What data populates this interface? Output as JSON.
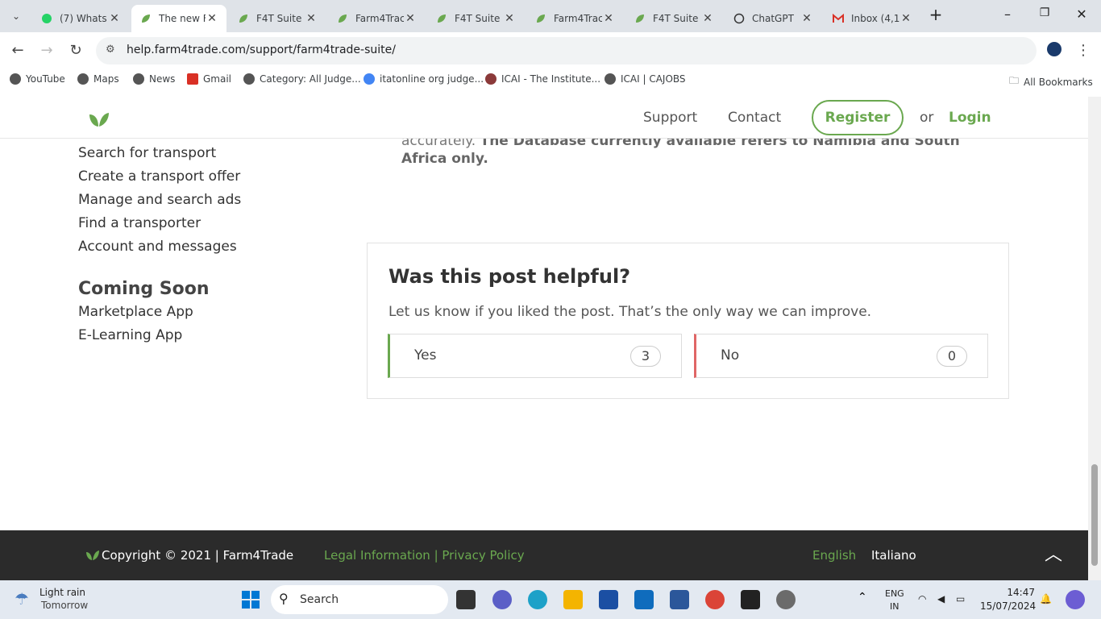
{
  "browser": {
    "tabs": [
      {
        "title": "(7) Whats",
        "active": false
      },
      {
        "title": "The new F",
        "active": true
      },
      {
        "title": "F4T Suite",
        "active": false
      },
      {
        "title": "Farm4Trac",
        "active": false
      },
      {
        "title": "F4T Suite",
        "active": false
      },
      {
        "title": "Farm4Trac",
        "active": false
      },
      {
        "title": "F4T Suite",
        "active": false
      },
      {
        "title": "ChatGPT",
        "active": false
      },
      {
        "title": "Inbox (4,1",
        "active": false
      }
    ],
    "url": "help.farm4trade.com/support/farm4trade-suite/",
    "bookmarks": [
      "YouTube",
      "Maps",
      "News",
      "Gmail",
      "Category: All Judge...",
      "itatonline org judge...",
      "ICAI - The Institute...",
      "ICAI | CAJOBS"
    ],
    "all_bookmarks": "All Bookmarks"
  },
  "header": {
    "support": "Support",
    "contact": "Contact",
    "register": "Register",
    "or": "or",
    "login": "Login"
  },
  "sidebar": {
    "links": [
      "Search for transport",
      "Create a transport offer",
      "Manage and search ads",
      "Find a transporter",
      "Account and messages"
    ],
    "coming_soon_title": "Coming Soon",
    "coming_soon": [
      "Marketplace App",
      "E-Learning App"
    ]
  },
  "content": {
    "intro_plain": "accurately.",
    "intro_bold": "The Database currently available refers to Namibia and South Africa only."
  },
  "feedback": {
    "title": "Was this post helpful?",
    "subtitle": "Let us know if you liked the post. That’s the only way we can improve.",
    "yes_label": "Yes",
    "yes_count": "3",
    "no_label": "No",
    "no_count": "0"
  },
  "footer": {
    "copyright": "Copyright © 2021 | Farm4Trade",
    "legal": "Legal Information | Privacy Policy",
    "lang_en": "English",
    "lang_it": "Italiano"
  },
  "taskbar": {
    "weather_title": "Light rain",
    "weather_sub": "Tomorrow",
    "search": "Search",
    "lang": "ENG",
    "region": "IN",
    "time": "14:47",
    "date": "15/07/2024"
  },
  "colors": {
    "brand_green": "#6aa84f",
    "no_red": "#e06666"
  }
}
